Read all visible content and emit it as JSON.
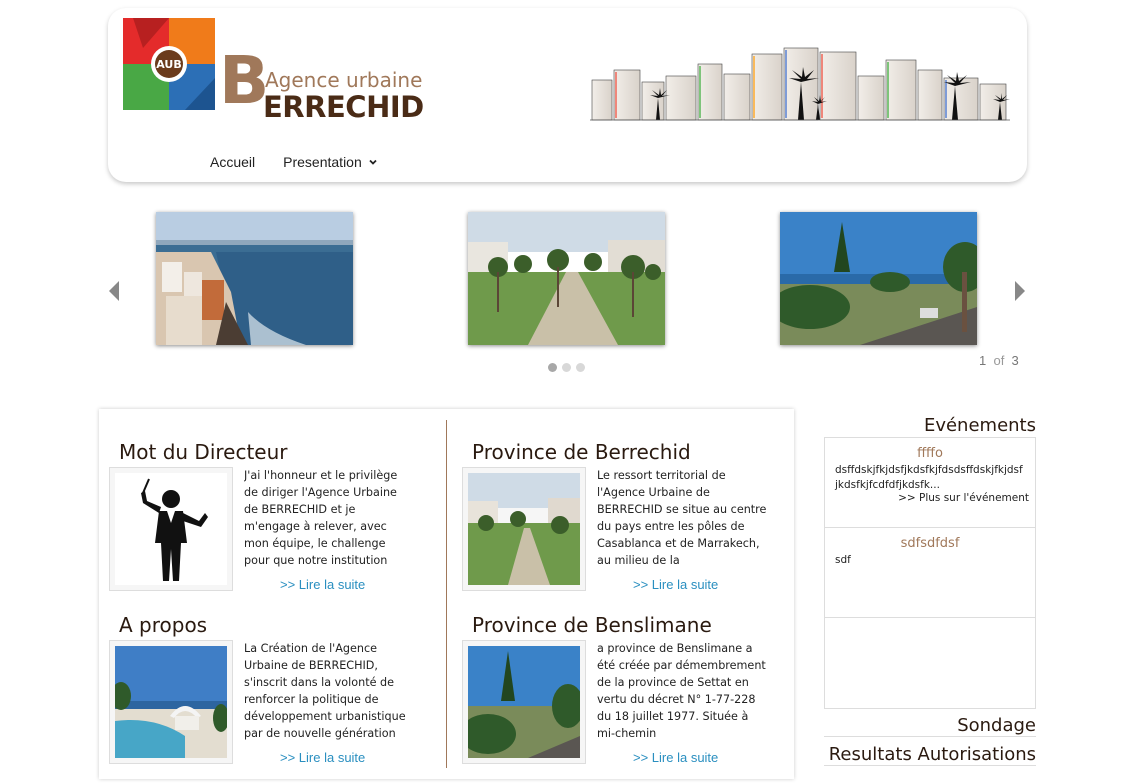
{
  "logo": {
    "badge": "AUB",
    "letter": "B",
    "subtitle": "Agence urbaine",
    "title": "ERRECHID"
  },
  "nav": {
    "items": [
      {
        "label": "Accueil"
      },
      {
        "label": "Presentation",
        "has_dropdown": true
      }
    ]
  },
  "carousel": {
    "current_page": "1",
    "of_label": "of",
    "total_pages": "3",
    "dots": 3,
    "active_dot": 0
  },
  "articles": [
    {
      "title": "Mot du Directeur",
      "text": "J'ai l'honneur et le privilège de diriger l'Agence Urbaine de BERRECHID et je m'engage à relever, avec mon équipe, le challenge pour que notre institution devienne un acteur",
      "more": ">> Lire la suite",
      "icon": "director-icon"
    },
    {
      "title": "Province de Berrechid",
      "text": "Le ressort territorial de l'Agence Urbaine de BERRECHID se situe au centre du pays entre les pôles de Casablanca et de Marrakech, au milieu de la",
      "more": ">> Lire la suite",
      "icon": "park-photo"
    },
    {
      "title": "A propos",
      "text": "La Création de l'Agence Urbaine de BERRECHID, s'inscrit dans la volonté de renforcer la politique de développement urbanistique par de nouvelle génération",
      "more": ">> Lire la suite",
      "icon": "pool-photo"
    },
    {
      "title": "Province de Benslimane",
      "text": "a province de Benslimane a été créée par démembrement de la province de Settat en vertu du décret N° 1-77-228 du 18 juillet 1977. Située à mi-chemin",
      "more": ">> Lire la suite",
      "icon": "palm-photo"
    }
  ],
  "events": {
    "title": "Evénements",
    "items": [
      {
        "title": "ffffo",
        "desc": "dsffdskjfkjdsfjkdsfkjfdsdsffdskjfkjdsfjkdsfkjfcdfdfjkdsfk...",
        "more": ">> Plus sur l'événement"
      },
      {
        "title": "sdfsdfdsf",
        "desc": "sdf",
        "more": ""
      },
      {
        "title": "",
        "desc": "",
        "more": ""
      }
    ]
  },
  "sondage": {
    "title": "Sondage"
  },
  "resultats": {
    "title": "Resultats Autorisations"
  },
  "colors": {
    "brand_brown": "#a0785a",
    "dark_brown": "#4a2b16",
    "link_blue": "#2a8fc0"
  }
}
